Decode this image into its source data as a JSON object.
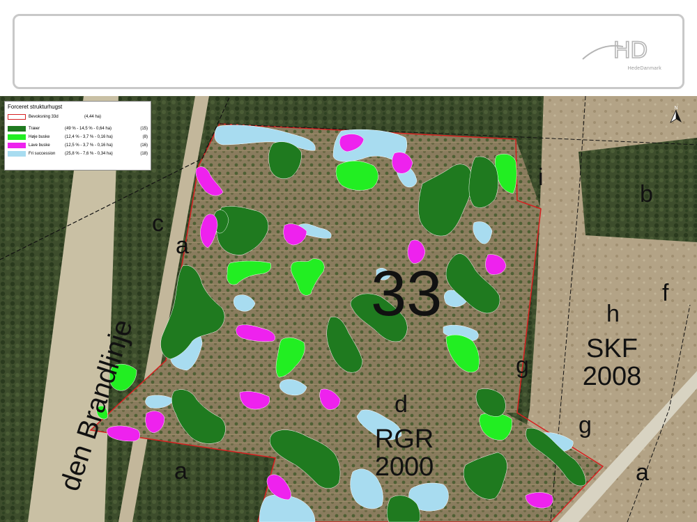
{
  "header": {
    "logo_text": "HD",
    "logo_subtext": "HedeDanmark"
  },
  "map": {
    "stand_number": "33",
    "labels": {
      "c": "c",
      "a_top": "a",
      "a_bottom": "a",
      "a_right": "a",
      "b": "b",
      "i": "i",
      "f": "f",
      "h": "h",
      "g_mid": "g",
      "g_low": "g",
      "d": "d",
      "skf": "SKF",
      "skf_year": "2008",
      "rgr": "RGR",
      "rgr_year": "2000",
      "road": "den Brandlinje"
    },
    "north_arrow": "N"
  },
  "legend": {
    "title": "Forceret strukturhugst",
    "items": [
      {
        "name": "Bevoksning 33d",
        "detail": "(4,44 ha)",
        "count": "",
        "color": "#d62020",
        "style": "outline"
      },
      {
        "name": "Træer",
        "detail": "(49 % - 14,5 % - 0,64 ha)",
        "count": "(15)",
        "color": "#1f7a1f",
        "style": "fill"
      },
      {
        "name": "Høje buske",
        "detail": "(12,4 % - 3,7 % - 0,16 ha)",
        "count": "(8)",
        "color": "#22ee22",
        "style": "fill"
      },
      {
        "name": "Lave buske",
        "detail": "(12,5 % - 3,7 % - 0,16 ha)",
        "count": "(16)",
        "color": "#ee22ee",
        "style": "fill"
      },
      {
        "name": "Fri succession",
        "detail": "(25,8 % - 7,6 % - 0,34 ha)",
        "count": "(18)",
        "color": "#a8dcf0",
        "style": "fill"
      }
    ]
  },
  "colors": {
    "trees": "#1f7a1f",
    "high_shrubs": "#22ee22",
    "low_shrubs": "#ee22ee",
    "free_succession": "#a8dcf0",
    "boundary": "#d62020"
  }
}
